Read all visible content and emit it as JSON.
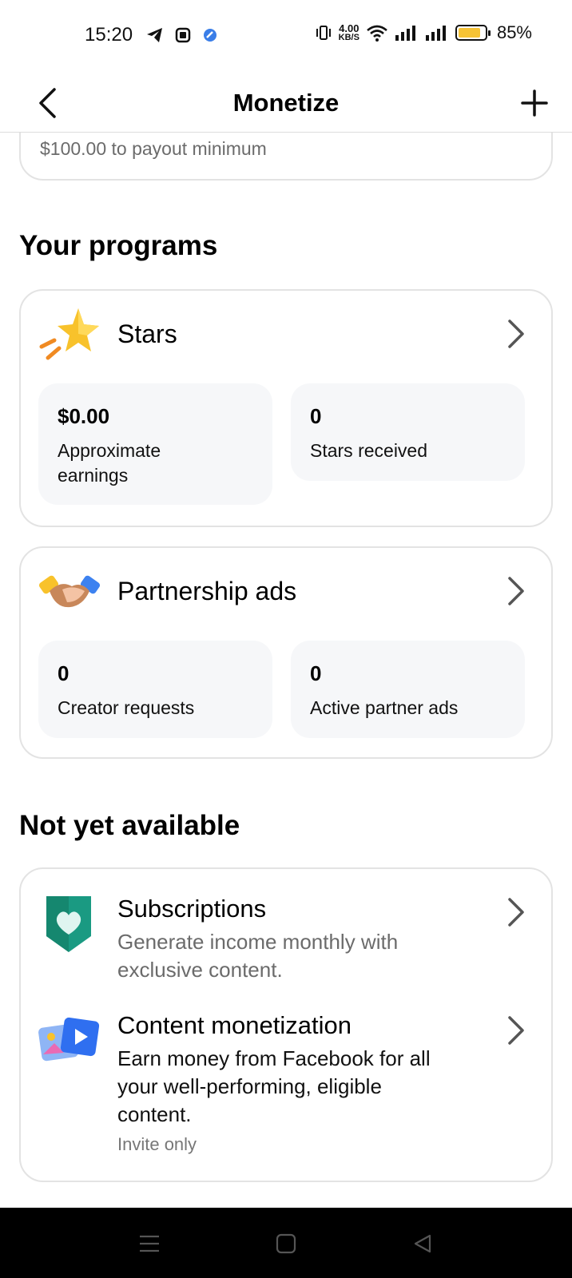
{
  "status_bar": {
    "time": "15:20",
    "net_speed_value": "4.00",
    "net_speed_unit": "KB/S",
    "battery_percent": "85%",
    "battery_level": 0.85,
    "battery_color": "#f6c335"
  },
  "header": {
    "title": "Monetize",
    "back_icon": "chevron-left-icon",
    "add_icon": "plus-icon"
  },
  "payout": {
    "text": "$100.00 to payout minimum"
  },
  "your_programs": {
    "title": "Your programs",
    "programs": [
      {
        "title": "Stars",
        "icon": "star-icon",
        "stats": [
          {
            "value": "$0.00",
            "label": "Approximate earnings"
          },
          {
            "value": "0",
            "label": "Stars received"
          }
        ]
      },
      {
        "title": "Partnership ads",
        "icon": "handshake-icon",
        "stats": [
          {
            "value": "0",
            "label": "Creator requests"
          },
          {
            "value": "0",
            "label": "Active partner ads"
          }
        ]
      }
    ]
  },
  "not_available": {
    "title": "Not yet available",
    "items": [
      {
        "title": "Subscriptions",
        "description": "Generate income monthly with exclusive content.",
        "icon": "heart-badge-icon"
      },
      {
        "title": "Content monetization",
        "description": "Earn money from Facebook for all your well-performing, eligible content.",
        "note": "Invite only",
        "icon": "media-icon"
      }
    ]
  },
  "nav": {
    "menu_icon": "menu-icon",
    "home_icon": "home-square-icon",
    "back_icon": "back-triangle-icon"
  }
}
